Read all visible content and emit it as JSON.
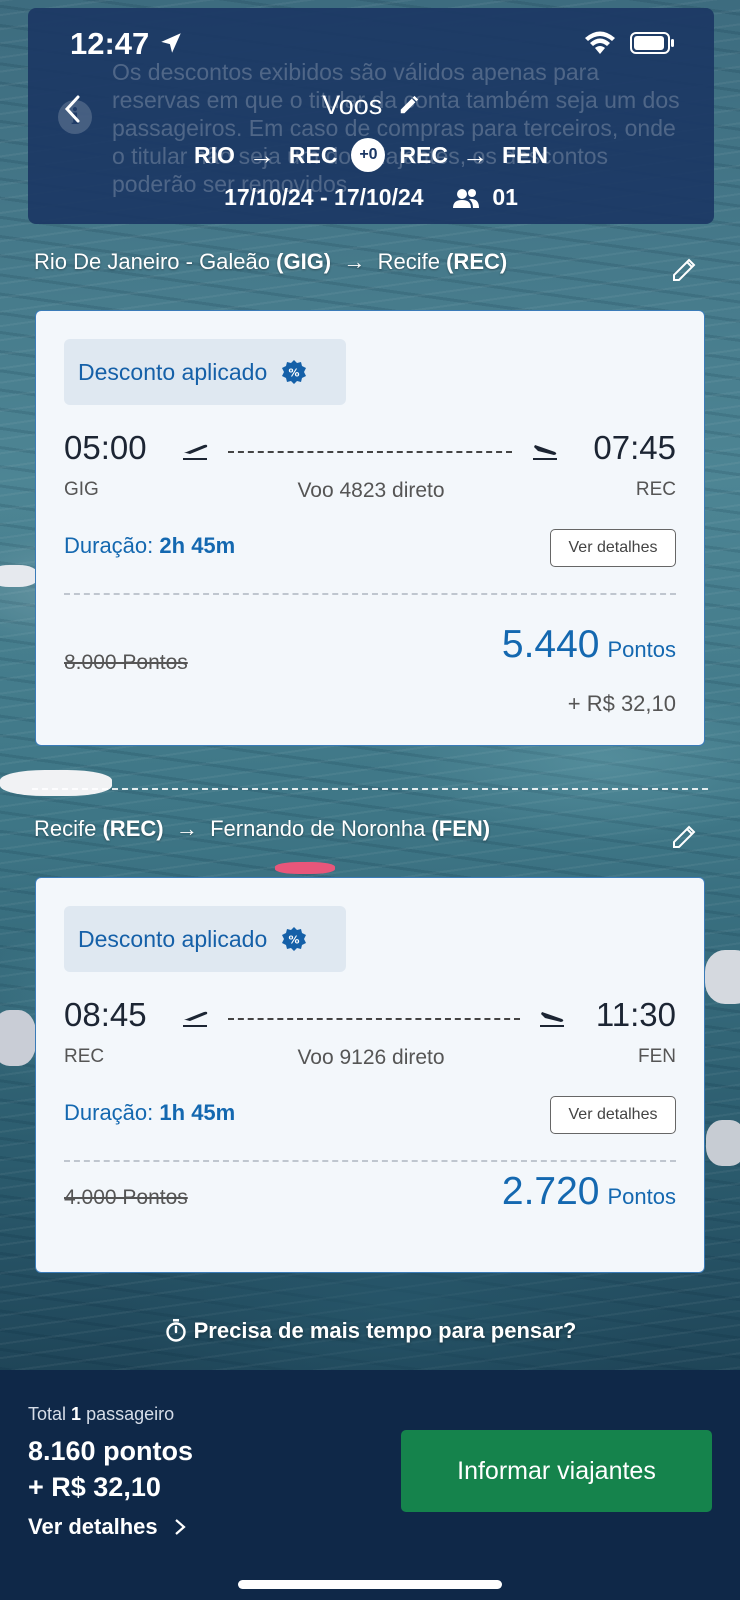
{
  "status_bar": {
    "time": "12:47"
  },
  "header": {
    "title": "Voos",
    "route": {
      "a": "RIO",
      "b": "REC",
      "plus": "+0",
      "c": "REC",
      "d": "FEN"
    },
    "dates": "17/10/24 - 17/10/24",
    "passengers": "01",
    "notice": "Os descontos exibidos são válidos apenas para reservas em que o titular da conta também seja um dos passageiros. Em caso de compras para terceiros, onde o titular não seja um dos viajantes, os descontos poderão ser removidos."
  },
  "segments": [
    {
      "from_city": "Rio De Janeiro - Galeão",
      "from_code": "(GIG)",
      "to_city": "Recife",
      "to_code": "(REC)",
      "discount_label": "Desconto aplicado",
      "dep_time": "05:00",
      "arr_time": "07:45",
      "dep_airport": "GIG",
      "arr_airport": "REC",
      "flight": "Voo 4823 direto",
      "duration_label": "Duração:",
      "duration": "2h 45m",
      "details_label": "Ver detalhes",
      "old_price": "8.000 Pontos",
      "new_price": "5.440",
      "price_unit": "Pontos",
      "tax": "+ R$ 32,10"
    },
    {
      "from_city": "Recife",
      "from_code": "(REC)",
      "to_city": "Fernando de Noronha",
      "to_code": "(FEN)",
      "discount_label": "Desconto aplicado",
      "dep_time": "08:45",
      "arr_time": "11:30",
      "dep_airport": "REC",
      "arr_airport": "FEN",
      "flight": "Voo 9126 direto",
      "duration_label": "Duração:",
      "duration": "1h 45m",
      "details_label": "Ver detalhes",
      "old_price": "4.000 Pontos",
      "new_price": "2.720",
      "price_unit": "Pontos"
    }
  ],
  "more_time": "Precisa de mais tempo para pensar?",
  "footer": {
    "total_prefix": "Total",
    "passenger_count": "1",
    "passenger_word": "passageiro",
    "total_points": "8.160 pontos",
    "total_money": "+ R$ 32,10",
    "details": "Ver detalhes",
    "cta": "Informar viajantes"
  },
  "colors": {
    "header_bg": "#1b3764",
    "accent_blue": "#1468b0",
    "cta_green": "#15834c",
    "footer_bg": "#0f2848"
  }
}
